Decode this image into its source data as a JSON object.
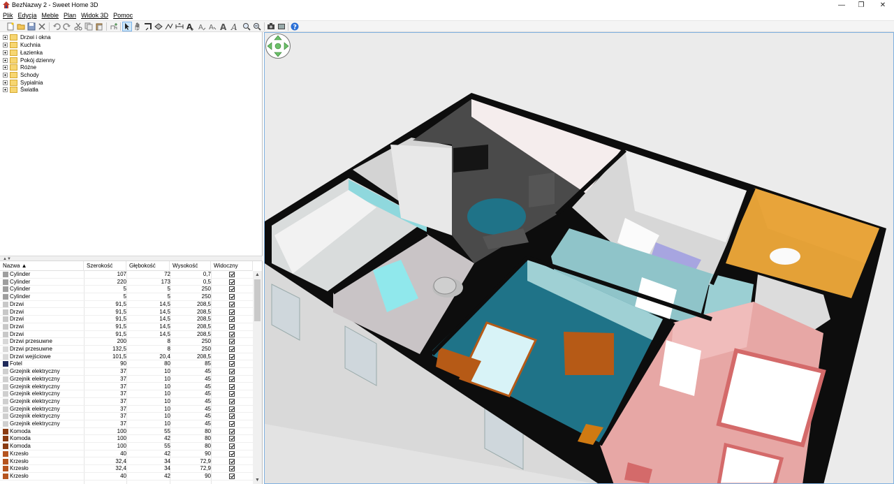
{
  "window": {
    "title": "BezNazwy 2 - Sweet Home 3D",
    "controls": {
      "minimize": "—",
      "restore": "❐",
      "close": "✕"
    }
  },
  "menu": [
    "Plik",
    "Edycja",
    "Meble",
    "Plan",
    "Widok 3D",
    "Pomoc"
  ],
  "toolbar": {
    "icons": [
      "new-file-icon",
      "open-folder-icon",
      "save-icon",
      "cut-preferences-icon",
      "undo-icon",
      "redo-icon",
      "cut-icon",
      "copy-icon",
      "paste-icon",
      "add-furniture-icon",
      "select-arrow-icon",
      "pan-hand-icon",
      "create-walls-icon",
      "create-rooms-icon",
      "create-polylines-icon",
      "create-dimensions-icon",
      "add-text-icon",
      "text-style-a1-icon",
      "text-style-a2-icon",
      "text-style-a3-icon",
      "text-style-a4-icon",
      "zoom-in-icon",
      "zoom-out-icon",
      "create-photo-icon",
      "create-video-icon",
      "help-icon"
    ],
    "selected": "select-arrow-icon"
  },
  "catalog": {
    "categories": [
      "Drzwi i okna",
      "Kuchnia",
      "Łazienka",
      "Pokój dzienny",
      "Różne",
      "Schody",
      "Sypialnia",
      "Światła"
    ]
  },
  "furniture_table": {
    "columns": {
      "name": "Nazwa ▲",
      "width": "Szerokość",
      "depth": "Głębokość",
      "height": "Wysokość",
      "visible": "Widoczny"
    },
    "rows": [
      {
        "name": "Cylinder",
        "width": "107",
        "depth": "72",
        "height": "0,7",
        "icon_color": "#9e9e9e"
      },
      {
        "name": "Cylinder",
        "width": "220",
        "depth": "173",
        "height": "0,5",
        "icon_color": "#9e9e9e"
      },
      {
        "name": "Cylinder",
        "width": "5",
        "depth": "5",
        "height": "250",
        "icon_color": "#9e9e9e"
      },
      {
        "name": "Cylinder",
        "width": "5",
        "depth": "5",
        "height": "250",
        "icon_color": "#9e9e9e"
      },
      {
        "name": "Drzwi",
        "width": "91,5",
        "depth": "14,5",
        "height": "208,5",
        "icon_color": "#c8c8c8"
      },
      {
        "name": "Drzwi",
        "width": "91,5",
        "depth": "14,5",
        "height": "208,5",
        "icon_color": "#c8c8c8"
      },
      {
        "name": "Drzwi",
        "width": "91,5",
        "depth": "14,5",
        "height": "208,5",
        "icon_color": "#c8c8c8"
      },
      {
        "name": "Drzwi",
        "width": "91,5",
        "depth": "14,5",
        "height": "208,5",
        "icon_color": "#c8c8c8"
      },
      {
        "name": "Drzwi",
        "width": "91,5",
        "depth": "14,5",
        "height": "208,5",
        "icon_color": "#c8c8c8"
      },
      {
        "name": "Drzwi przesuwne",
        "width": "200",
        "depth": "8",
        "height": "250",
        "icon_color": "#d8d8d8"
      },
      {
        "name": "Drzwi przesuwne",
        "width": "132,5",
        "depth": "8",
        "height": "250",
        "icon_color": "#d8d8d8"
      },
      {
        "name": "Drzwi wejściowe",
        "width": "101,5",
        "depth": "20,4",
        "height": "208,5",
        "icon_color": "#d8d8d8"
      },
      {
        "name": "Fotel",
        "width": "90",
        "depth": "80",
        "height": "85",
        "icon_color": "#1f2a5a"
      },
      {
        "name": "Grzejnik elektryczny",
        "width": "37",
        "depth": "10",
        "height": "45",
        "icon_color": "#cfcfcf"
      },
      {
        "name": "Grzejnik elektryczny",
        "width": "37",
        "depth": "10",
        "height": "45",
        "icon_color": "#cfcfcf"
      },
      {
        "name": "Grzejnik elektryczny",
        "width": "37",
        "depth": "10",
        "height": "45",
        "icon_color": "#cfcfcf"
      },
      {
        "name": "Grzejnik elektryczny",
        "width": "37",
        "depth": "10",
        "height": "45",
        "icon_color": "#cfcfcf"
      },
      {
        "name": "Grzejnik elektryczny",
        "width": "37",
        "depth": "10",
        "height": "45",
        "icon_color": "#cfcfcf"
      },
      {
        "name": "Grzejnik elektryczny",
        "width": "37",
        "depth": "10",
        "height": "45",
        "icon_color": "#cfcfcf"
      },
      {
        "name": "Grzejnik elektryczny",
        "width": "37",
        "depth": "10",
        "height": "45",
        "icon_color": "#cfcfcf"
      },
      {
        "name": "Grzejnik elektryczny",
        "width": "37",
        "depth": "10",
        "height": "45",
        "icon_color": "#cfcfcf"
      },
      {
        "name": "Komoda",
        "width": "100",
        "depth": "55",
        "height": "80",
        "icon_color": "#8a3b12"
      },
      {
        "name": "Komoda",
        "width": "100",
        "depth": "42",
        "height": "80",
        "icon_color": "#8a3b12"
      },
      {
        "name": "Komoda",
        "width": "100",
        "depth": "55",
        "height": "80",
        "icon_color": "#8a3b12"
      },
      {
        "name": "Krzesło",
        "width": "40",
        "depth": "42",
        "height": "90",
        "icon_color": "#b5541f"
      },
      {
        "name": "Krzesło",
        "width": "32,4",
        "depth": "34",
        "height": "72,9",
        "icon_color": "#b5541f"
      },
      {
        "name": "Krzesło",
        "width": "32,4",
        "depth": "34",
        "height": "72,9",
        "icon_color": "#b5541f"
      },
      {
        "name": "Krzesło",
        "width": "40",
        "depth": "42",
        "height": "90",
        "icon_color": "#b5541f"
      }
    ]
  },
  "colors": {
    "wall_top": "#0d0d0d",
    "floor_living": "#4a4a4a",
    "rug_teal": "#1f7388",
    "room_orange": "#e4a137",
    "room_pink": "#e7a7a5",
    "room_teal": "#8fc4c9",
    "bedroom_cyan": "#9fd0d4",
    "furniture_brown": "#b65a16",
    "selection_blue": "#7fb0e0"
  }
}
